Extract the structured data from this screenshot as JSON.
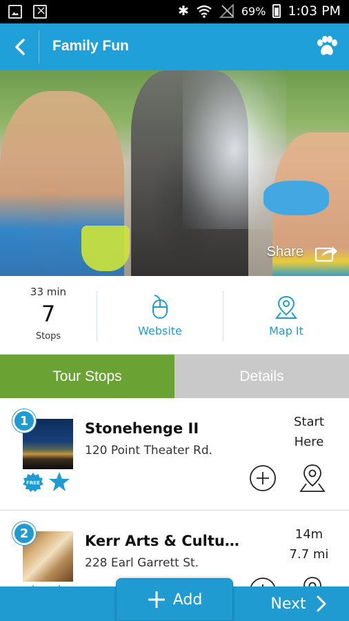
{
  "status_bar": {
    "battery": "69%",
    "time": "1:03 PM",
    "icons": [
      "image-icon",
      "close-notification-icon",
      "bluetooth-icon",
      "wifi-icon",
      "no-signal-icon",
      "battery-icon"
    ]
  },
  "app_bar": {
    "title": "Family Fun",
    "back_icon": "chevron-left-icon",
    "action_icon": "paw-icon"
  },
  "hero": {
    "share_label": "Share"
  },
  "stats": {
    "duration": "33 min",
    "stops_count": "7",
    "stops_label": "Stops",
    "website_label": "Website",
    "mapit_label": "Map It"
  },
  "tabs": [
    {
      "label": "Tour Stops",
      "active": true
    },
    {
      "label": "Details",
      "active": false
    }
  ],
  "stops": [
    {
      "number": "1",
      "name": "Stonehenge II",
      "address": "120 Point Theater Rd.",
      "right_line1": "Start",
      "right_line2": "Here",
      "badges": [
        "free-icon",
        "star-icon"
      ]
    },
    {
      "number": "2",
      "name": "Kerr Arts & Cultur...",
      "address": "228 Earl Garrett St.",
      "right_line1": "14m",
      "right_line2": "7.7 mi",
      "badges": [
        "free-icon",
        "star-icon"
      ]
    }
  ],
  "bottom_bar": {
    "add_label": "Add",
    "next_label": "Next"
  },
  "colors": {
    "primary": "#1fa0d8",
    "tab_active": "#6aa233",
    "tab_inactive": "#c9c9c9"
  }
}
